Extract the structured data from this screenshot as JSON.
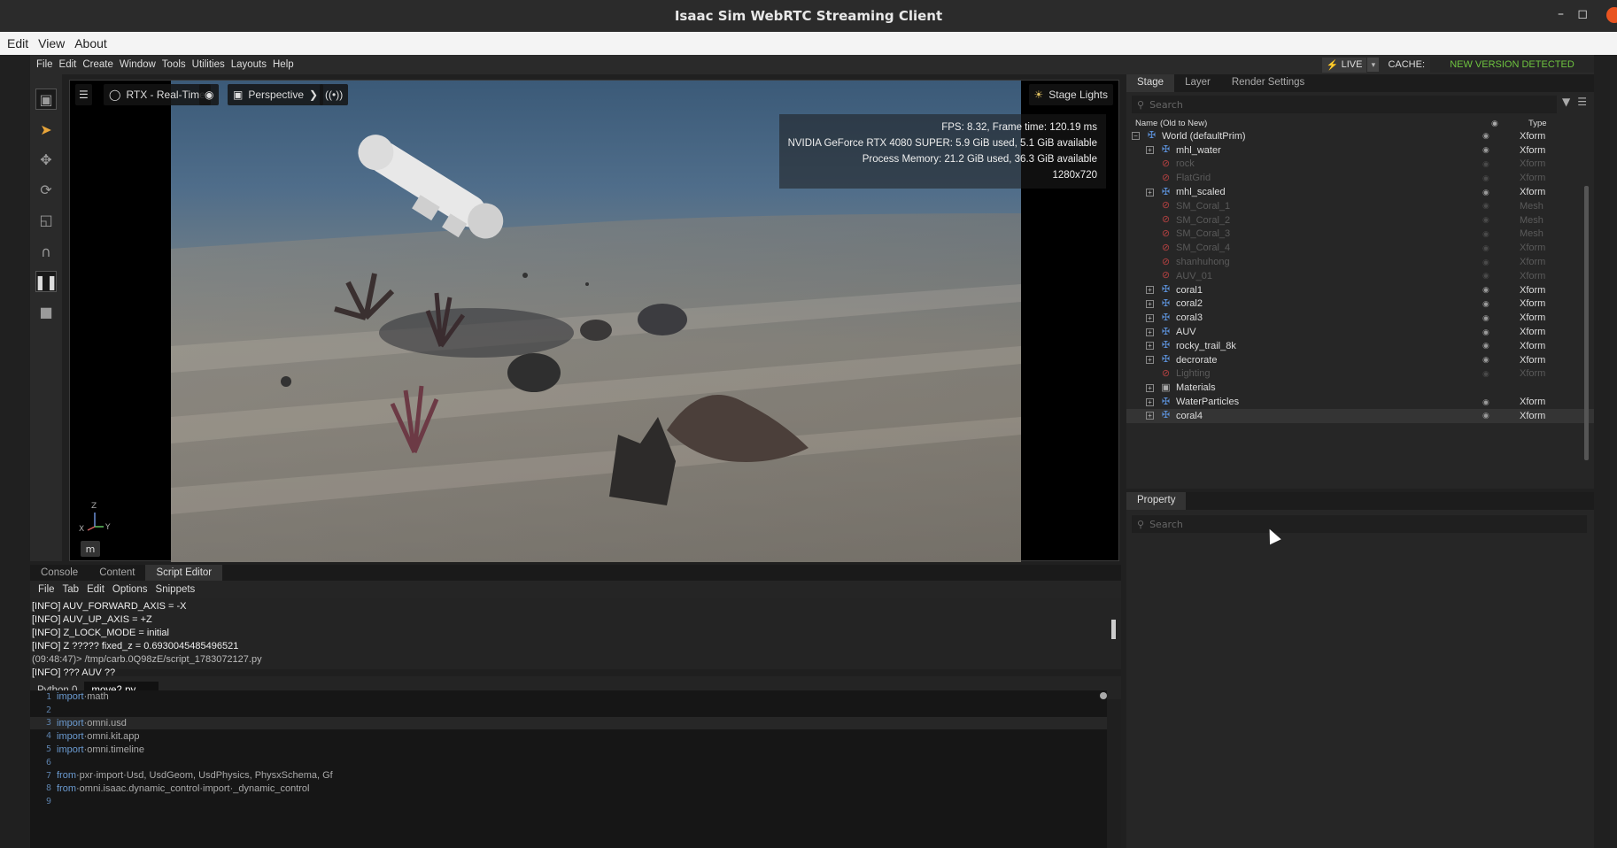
{
  "window": {
    "title": "Isaac Sim WebRTC Streaming Client"
  },
  "outer_menu": [
    "Edit",
    "View",
    "About"
  ],
  "app_menu": [
    "File",
    "Edit",
    "Create",
    "Window",
    "Tools",
    "Utilities",
    "Layouts",
    "Help"
  ],
  "status": {
    "live": "LIVE",
    "cache": "CACHE:",
    "new_version": "NEW VERSION DETECTED"
  },
  "viewport": {
    "render_mode": "RTX - Real-Time",
    "camera": "Perspective",
    "lights": "Stage Lights",
    "stats": [
      "FPS: 8.32, Frame time: 120.19 ms",
      "NVIDIA GeForce RTX 4080 SUPER: 5.9 GiB used, 5.1 GiB available",
      "Process Memory: 21.2 GiB used, 36.3 GiB available",
      "1280x720"
    ],
    "axis": {
      "x": "X",
      "y": "Y",
      "z": "Z"
    },
    "units_button": "m"
  },
  "stage": {
    "tabs": [
      "Stage",
      "Layer",
      "Render Settings"
    ],
    "search_placeholder": "Search",
    "col_name": "Name (Old to New)",
    "col_type": "Type",
    "rows": [
      {
        "name": "World (defaultPrim)",
        "type": "Xform",
        "level": 0,
        "icon": "xform-icon",
        "expand": "−",
        "visible": true,
        "selected": false
      },
      {
        "name": "mhl_water",
        "type": "Xform",
        "level": 1,
        "icon": "xform-icon",
        "expand": "+",
        "visible": true,
        "selected": false
      },
      {
        "name": "rock",
        "type": "Xform",
        "level": 1,
        "icon": "disabled-icon",
        "expand": "",
        "visible": false,
        "selected": false
      },
      {
        "name": "FlatGrid",
        "type": "Xform",
        "level": 1,
        "icon": "disabled-icon",
        "expand": "",
        "visible": false,
        "selected": false
      },
      {
        "name": "mhl_scaled",
        "type": "Xform",
        "level": 1,
        "icon": "xform-icon",
        "expand": "+",
        "visible": true,
        "selected": false
      },
      {
        "name": "SM_Coral_1",
        "type": "Mesh",
        "level": 1,
        "icon": "disabled-icon",
        "expand": "",
        "visible": false,
        "selected": false
      },
      {
        "name": "SM_Coral_2",
        "type": "Mesh",
        "level": 1,
        "icon": "disabled-icon",
        "expand": "",
        "visible": false,
        "selected": false
      },
      {
        "name": "SM_Coral_3",
        "type": "Mesh",
        "level": 1,
        "icon": "disabled-icon",
        "expand": "",
        "visible": false,
        "selected": false
      },
      {
        "name": "SM_Coral_4",
        "type": "Xform",
        "level": 1,
        "icon": "disabled-icon",
        "expand": "",
        "visible": false,
        "selected": false
      },
      {
        "name": "shanhuhong",
        "type": "Xform",
        "level": 1,
        "icon": "disabled-icon",
        "expand": "",
        "visible": false,
        "selected": false
      },
      {
        "name": "AUV_01",
        "type": "Xform",
        "level": 1,
        "icon": "disabled-icon",
        "expand": "",
        "visible": false,
        "selected": false
      },
      {
        "name": "coral1",
        "type": "Xform",
        "level": 1,
        "icon": "xform-icon",
        "expand": "+",
        "visible": true,
        "selected": false
      },
      {
        "name": "coral2",
        "type": "Xform",
        "level": 1,
        "icon": "xform-icon",
        "expand": "+",
        "visible": true,
        "selected": false
      },
      {
        "name": "coral3",
        "type": "Xform",
        "level": 1,
        "icon": "xform-icon",
        "expand": "+",
        "visible": true,
        "selected": false
      },
      {
        "name": "AUV",
        "type": "Xform",
        "level": 1,
        "icon": "xform-icon",
        "expand": "+",
        "visible": true,
        "selected": false
      },
      {
        "name": "rocky_trail_8k",
        "type": "Xform",
        "level": 1,
        "icon": "xform-icon",
        "expand": "+",
        "visible": true,
        "selected": false
      },
      {
        "name": "decrorate",
        "type": "Xform",
        "level": 1,
        "icon": "xform-icon",
        "expand": "+",
        "visible": true,
        "selected": false
      },
      {
        "name": "Lighting",
        "type": "Xform",
        "level": 1,
        "icon": "disabled-icon",
        "expand": "",
        "visible": false,
        "selected": false
      },
      {
        "name": "Materials",
        "type": "",
        "level": 1,
        "icon": "scope-icon",
        "expand": "+",
        "visible": null,
        "selected": false
      },
      {
        "name": "WaterParticles",
        "type": "Xform",
        "level": 1,
        "icon": "xform-icon",
        "expand": "+",
        "visible": true,
        "selected": false
      },
      {
        "name": "coral4",
        "type": "Xform",
        "level": 1,
        "icon": "xform-icon",
        "expand": "+",
        "visible": true,
        "selected": true
      }
    ]
  },
  "property": {
    "tab": "Property",
    "search_placeholder": "Search"
  },
  "bottom": {
    "tabs": [
      "Console",
      "Content",
      "Script Editor"
    ],
    "active_tab": "Script Editor",
    "menu": [
      "File",
      "Tab",
      "Edit",
      "Options",
      "Snippets"
    ],
    "log": [
      "[INFO] AUV_FORWARD_AXIS = -X",
      "[INFO] AUV_UP_AXIS = +Z",
      "[INFO] Z_LOCK_MODE = initial",
      "[INFO] Z ????? fixed_z = 0.6930045485496521",
      "(09:48:47)> /tmp/carb.0Q98zE/script_1783072127.py",
      "[INFO] ??? AUV ??"
    ],
    "file_tabs": [
      "Python 0",
      "move2.py"
    ],
    "code": [
      {
        "n": "1",
        "kw": "import",
        "rest": "·math"
      },
      {
        "n": "2",
        "kw": "",
        "rest": ""
      },
      {
        "n": "3",
        "kw": "import",
        "rest": "·omni.usd"
      },
      {
        "n": "4",
        "kw": "import",
        "rest": "·omni.kit.app"
      },
      {
        "n": "5",
        "kw": "import",
        "rest": "·omni.timeline"
      },
      {
        "n": "6",
        "kw": "",
        "rest": ""
      },
      {
        "n": "7",
        "kw": "from",
        "rest": "·pxr·import·Usd, UsdGeom, UsdPhysics, PhysxSchema, Gf"
      },
      {
        "n": "8",
        "kw": "from",
        "rest": "·omni.isaac.dynamic_control·import·_dynamic_control"
      },
      {
        "n": "9",
        "kw": "",
        "rest": ""
      }
    ]
  },
  "colors": {
    "accent_green": "#6ec43f",
    "live_bolt": "#f5c518",
    "xform_blue": "#5b8fd6",
    "disabled_red": "#b04040"
  }
}
